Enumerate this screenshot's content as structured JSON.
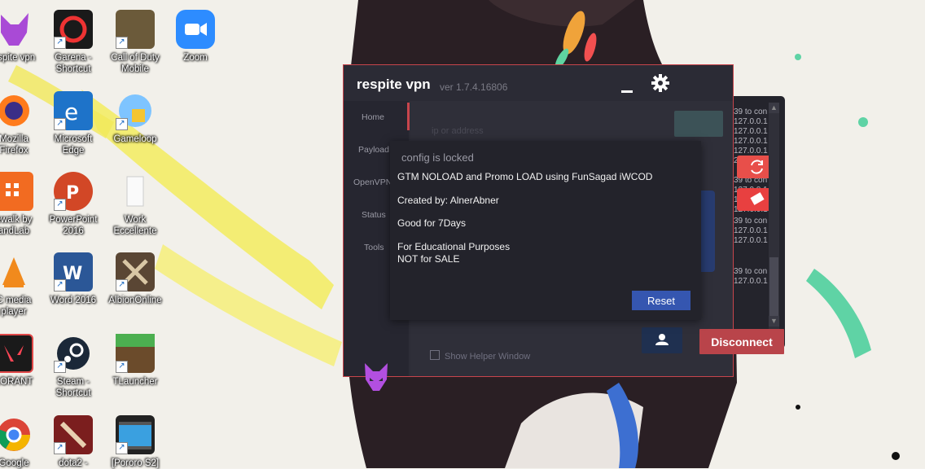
{
  "desktop": {
    "icons": [
      {
        "label": "espite vpn"
      },
      {
        "label": "Garena -\nShortcut"
      },
      {
        "label": "Call of Duty\nMobile"
      },
      {
        "label": "Zoom"
      },
      {
        "label": "Mozilla\nFirefox"
      },
      {
        "label": "Microsoft\nEdge"
      },
      {
        "label": "Gameloop"
      },
      {
        "label": "ewalk by\nandLab"
      },
      {
        "label": "PowerPoint\n2016"
      },
      {
        "label": "Work\nEccellente"
      },
      {
        "label": "C media\nplayer"
      },
      {
        "label": "Word 2016"
      },
      {
        "label": "AlbionOnline"
      },
      {
        "label": "LORANT"
      },
      {
        "label": "Steam -\nShortcut"
      },
      {
        "label": "TLauncher"
      },
      {
        "label": "Google"
      },
      {
        "label": "dota2 -"
      },
      {
        "label": "[Pororo S2]"
      }
    ]
  },
  "vpn": {
    "title": "respite vpn",
    "version": "ver 1.7.4.16806",
    "nav": [
      "Home",
      "Payload",
      "OpenVPN",
      "Status",
      "Tools"
    ],
    "input_placeholder": "ip or address",
    "helper_checkbox": "Show Helper Window",
    "disconnect_label": "Disconnect"
  },
  "dialog": {
    "title": "config is locked",
    "line1": "GTM NOLOAD and Promo LOAD using FunSagad iWCOD",
    "line2": "Created by: AlnerAbner",
    "line3": "Good for 7Days",
    "line4": "For Educational Purposes",
    "line5": "NOT for SALE",
    "reset_label": "Reset"
  },
  "log": {
    "lines": [
      "39 to con",
      "127.0.0.1",
      "127.0.0.1",
      "127.0.0.1",
      "127.0.0.1",
      "27.0.0.1:",
      "39 to con",
      "127.0.0.1",
      "127.0.0.1",
      "127.0.0.1",
      "39 to con",
      "127.0.0.1",
      "127.0.0.1",
      "39 to con",
      "127.0.0.1"
    ]
  },
  "colors": {
    "accent": "#c8454c",
    "reset": "#3556b0",
    "window_bg": "#2d2d37"
  }
}
